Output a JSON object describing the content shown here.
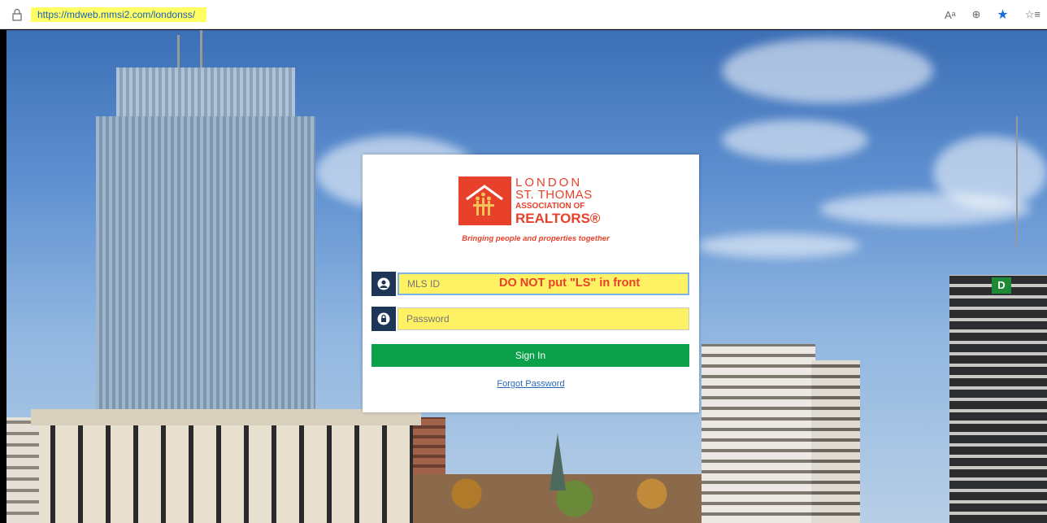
{
  "browser": {
    "url": "https://mdweb.mmsi2.com/londonss/",
    "read_aloud": "Aᵃ",
    "zoom_icon": "zoom-icon",
    "favorite_icon": "star-icon",
    "favorites_icon": "favorites-list-icon"
  },
  "logo": {
    "line1": "LONDON",
    "line2": "ST. THOMAS",
    "line3": "ASSOCIATION OF",
    "line4": "REALTORS®",
    "tagline": "Bringing people and properties together"
  },
  "form": {
    "mls_placeholder": "MLS ID",
    "password_placeholder": "Password",
    "warning": "DO NOT put \"LS\" in front",
    "signin_label": "Sign In",
    "forgot_label": "Forgot Password"
  },
  "colors": {
    "brand": "#e8412b",
    "icon_bg": "#1d3557",
    "signin": "#0aa14a",
    "highlight": "#fff164"
  },
  "background": {
    "sign_letter": "D"
  }
}
